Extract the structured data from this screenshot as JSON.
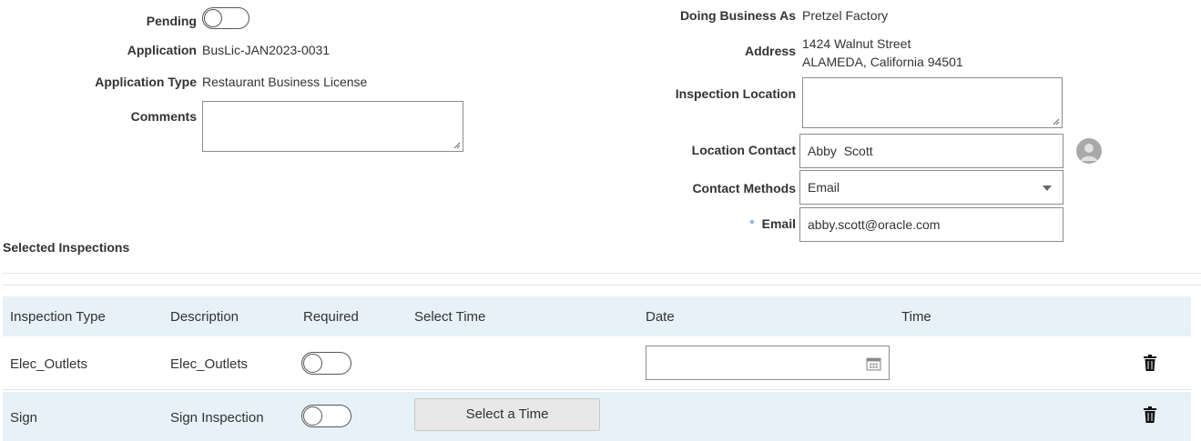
{
  "left_form": {
    "pending_label": "Pending",
    "application_label": "Application",
    "application_value": "BusLic-JAN2023-0031",
    "application_type_label": "Application Type",
    "application_type_value": "Restaurant Business License",
    "comments_label": "Comments",
    "comments_value": ""
  },
  "right_form": {
    "dba_label": "Doing Business As",
    "dba_value": "Pretzel Factory",
    "address_label": "Address",
    "address_line1": "1424 Walnut Street",
    "address_line2": "ALAMEDA, California 94501",
    "inspection_location_label": "Inspection Location",
    "inspection_location_value": "",
    "location_contact_label": "Location Contact",
    "location_contact_value": "Abby  Scott",
    "contact_methods_label": "Contact Methods",
    "contact_methods_value": "Email",
    "email_required_marker": "*",
    "email_label": "Email",
    "email_value": "abby.scott@oracle.com"
  },
  "inspections": {
    "title": "Selected Inspections",
    "columns": [
      "Inspection Type",
      "Description",
      "Required",
      "Select Time",
      "Date",
      "Time"
    ],
    "rows": [
      {
        "type": "Elec_Outlets",
        "description": "Elec_Outlets",
        "required": false,
        "date": ""
      },
      {
        "type": "Sign",
        "description": "Sign Inspection",
        "required": false,
        "select_time_label": "Select a Time"
      }
    ]
  },
  "colors": {
    "header_bg": "#e6f1f8",
    "selected_row_bg": "#e6f1f8",
    "required_star": "#4a8fc0"
  },
  "icons": {
    "contact": "user-avatar-icon",
    "date": "calendar-icon",
    "delete": "trash-icon"
  }
}
